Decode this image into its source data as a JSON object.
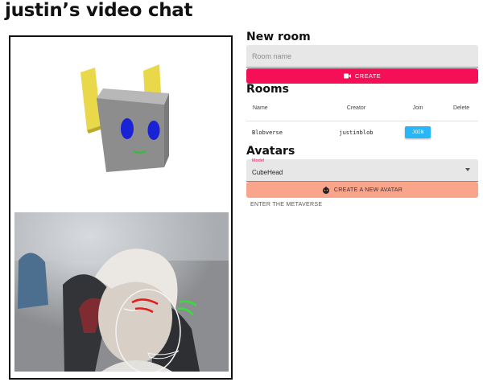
{
  "app": {
    "title": "justin’s video chat"
  },
  "new_room": {
    "heading": "New room",
    "input_placeholder": "Room name",
    "create_label": "CREATE",
    "create_icon": "video-camera-icon"
  },
  "rooms": {
    "heading": "Rooms",
    "columns": [
      "Name",
      "Creator",
      "Join",
      "Delete"
    ],
    "rows": [
      {
        "name": "Blobverse",
        "creator": "justinblob",
        "join_label": "JOIN"
      }
    ]
  },
  "avatars": {
    "heading": "Avatars",
    "model_label": "Model",
    "model_value": "CubeHead",
    "create_label": "CREATE A NEW AVATAR",
    "create_icon": "robot-face-icon",
    "enter_label": "ENTER THE METAVERSE"
  },
  "colors": {
    "create_button": "#f50f57",
    "join_button": "#29b6f6",
    "avatar_button": "#f9a58b"
  }
}
